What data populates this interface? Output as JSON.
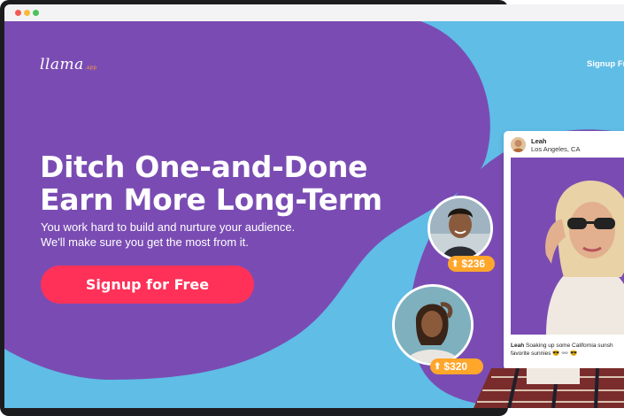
{
  "app": {
    "logo_text": "llama",
    "logo_tld": ".app"
  },
  "nav": {
    "signup_label": "Signup Free"
  },
  "hero": {
    "headline_line1": "Ditch One-and-Done",
    "headline_line2": "Earn More Long-Term",
    "sub_line1": "You work hard to build and nurture your audience.",
    "sub_line2": "We'll make sure you get the most from it.",
    "cta_label": "Signup for Free"
  },
  "creators": [
    {
      "earning": "$236",
      "icon": "up-arrow-icon"
    },
    {
      "earning": "$320",
      "icon": "up-arrow-icon"
    }
  ],
  "post": {
    "name": "Leah",
    "location": "Los Angeles, CA",
    "caption_user": "Leah",
    "caption_line1": "Soaking up some California sunsh",
    "caption_line2": "favorite sunnies 😎 👓 😎"
  },
  "colors": {
    "purple": "#7a4cb3",
    "sky": "#5fbde6",
    "cta": "#ff3158",
    "badge": "#ffa62b"
  }
}
